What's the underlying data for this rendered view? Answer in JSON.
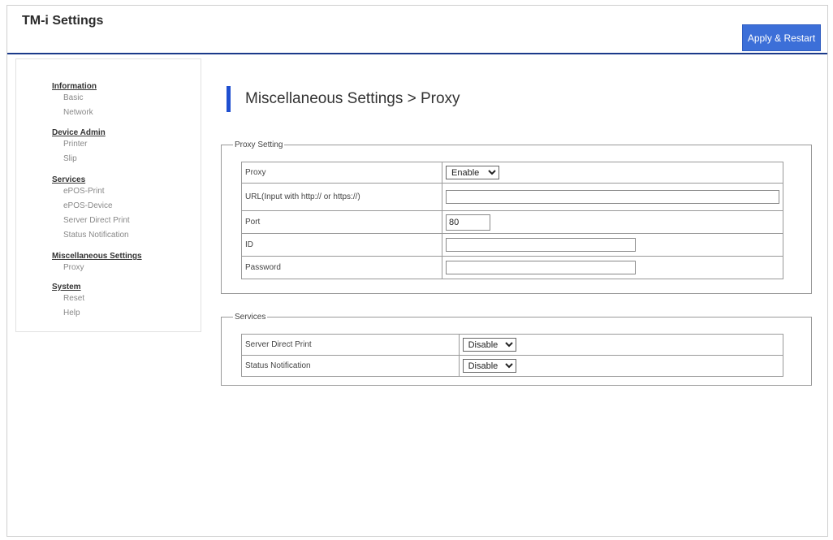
{
  "app": {
    "title": "TM-i Settings",
    "apply_button": "Apply & Restart"
  },
  "sidebar": {
    "groups": [
      {
        "label": "Information",
        "items": [
          "Basic",
          "Network"
        ]
      },
      {
        "label": "Device Admin",
        "items": [
          "Printer",
          "Slip"
        ]
      },
      {
        "label": "Services",
        "items": [
          "ePOS-Print",
          "ePOS-Device",
          "Server Direct Print",
          "Status Notification"
        ]
      },
      {
        "label": "Miscellaneous Settings",
        "items": [
          "Proxy"
        ]
      },
      {
        "label": "System",
        "items": [
          "Reset",
          "Help"
        ]
      }
    ]
  },
  "page": {
    "heading": "Miscellaneous Settings > Proxy"
  },
  "proxy_setting": {
    "legend": "Proxy Setting",
    "rows": {
      "proxy": {
        "label": "Proxy",
        "value": "Enable"
      },
      "url": {
        "label": "URL(Input with http:// or https://)",
        "value": ""
      },
      "port": {
        "label": "Port",
        "value": "80"
      },
      "id": {
        "label": "ID",
        "value": ""
      },
      "password": {
        "label": "Password",
        "value": ""
      }
    }
  },
  "services": {
    "legend": "Services",
    "rows": {
      "server_direct_print": {
        "label": "Server Direct Print",
        "value": "Disable"
      },
      "status_notification": {
        "label": "Status Notification",
        "value": "Disable"
      }
    }
  },
  "colors": {
    "accent": "#3c6fd8",
    "header_rule": "#1b3a8a",
    "heading_bar": "#1f4fd0"
  }
}
